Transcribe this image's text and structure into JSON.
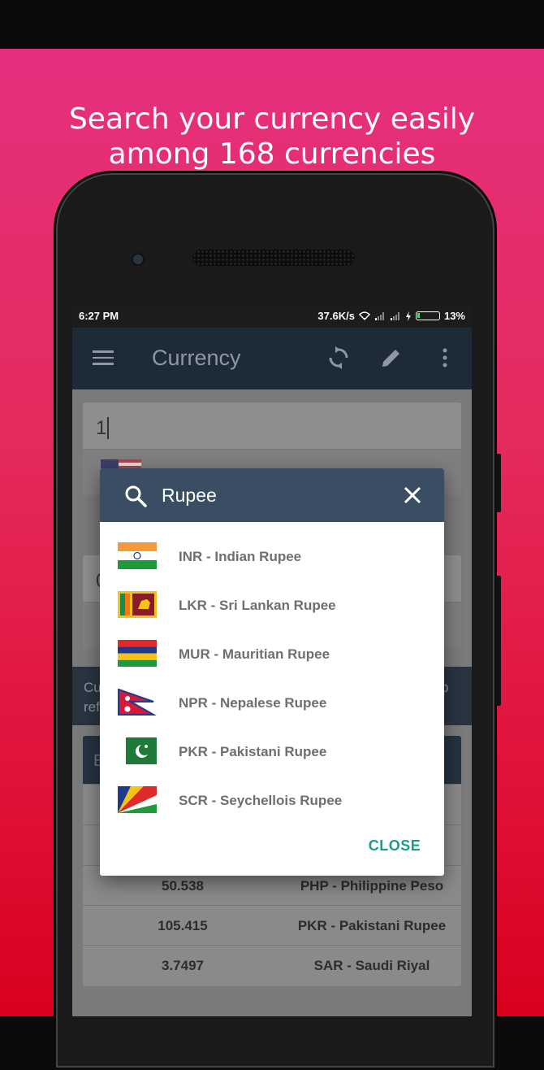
{
  "headline": {
    "line1": "Search your currency easily",
    "line2": "among 168 currencies"
  },
  "status_bar": {
    "time": "6:27 PM",
    "speed": "37.6K/s",
    "battery": "13%"
  },
  "toolbar": {
    "title": "Currency",
    "icons": [
      "menu-icon",
      "refresh-icon",
      "edit-icon",
      "more-vert-icon"
    ]
  },
  "converter": {
    "amount_value": "1",
    "second_card_partial": "0"
  },
  "info_band": {
    "left_partial_1": "Cu",
    "left_partial_2": "ref",
    "right_partial": "p"
  },
  "table": {
    "header_partial": "B",
    "rows": [
      {
        "rate": "50.538",
        "currency": "PHP - Philippine Peso"
      },
      {
        "rate": "105.415",
        "currency": "PKR - Pakistani Rupee"
      },
      {
        "rate": "3.7497",
        "currency": "SAR - Saudi Riyal"
      }
    ]
  },
  "search_dialog": {
    "query": "Rupee",
    "results": [
      {
        "code": "INR",
        "label": "INR - Indian Rupee",
        "flag": "india-flag-icon"
      },
      {
        "code": "LKR",
        "label": "LKR - Sri Lankan Rupee",
        "flag": "sri-lanka-flag-icon"
      },
      {
        "code": "MUR",
        "label": "MUR - Mauritian Rupee",
        "flag": "mauritius-flag-icon"
      },
      {
        "code": "NPR",
        "label": "NPR - Nepalese Rupee",
        "flag": "nepal-flag-icon"
      },
      {
        "code": "PKR",
        "label": "PKR - Pakistani Rupee",
        "flag": "pakistan-flag-icon"
      },
      {
        "code": "SCR",
        "label": "SCR - Seychellois Rupee",
        "flag": "seychelles-flag-icon"
      }
    ],
    "close_label": "CLOSE"
  },
  "colors": {
    "gradient_top": "#e5307f",
    "gradient_bottom": "#d9001e",
    "toolbar": "#1d2a37",
    "dialog_header": "#3a4d62",
    "accent": "#1a9c8c"
  }
}
